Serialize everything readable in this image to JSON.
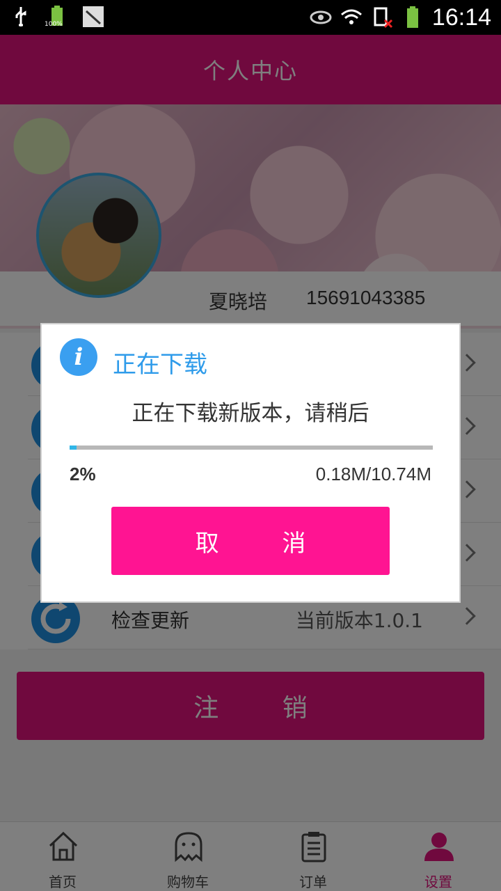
{
  "status_bar": {
    "time": "16:14",
    "battery_label": "100%"
  },
  "header": {
    "title": "个人中心"
  },
  "user": {
    "name": "夏晓培",
    "phone": "15691043385"
  },
  "menu": {
    "items": [
      {
        "label": "",
        "value": ""
      },
      {
        "label": "",
        "value": ""
      },
      {
        "label": "",
        "value": ""
      },
      {
        "label": "",
        "value": ""
      },
      {
        "label": "检查更新",
        "value": "当前版本1.0.1"
      }
    ]
  },
  "logout_label": "注 销",
  "bottom_nav": [
    {
      "label": "首页",
      "icon": "home-icon"
    },
    {
      "label": "购物车",
      "icon": "cart-icon"
    },
    {
      "label": "订单",
      "icon": "order-icon"
    },
    {
      "label": "设置",
      "icon": "person-icon",
      "active": true
    }
  ],
  "dialog": {
    "title": "正在下载",
    "message": "正在下载新版本，请稍后",
    "progress_percent_label": "2%",
    "progress_fraction": 0.02,
    "size_label": "0.18M/10.74M",
    "cancel_label": "取 消"
  },
  "colors": {
    "brand": "#e0127d",
    "accent": "#ff1492",
    "info": "#3a9ff0",
    "progress": "#31b6e7"
  }
}
